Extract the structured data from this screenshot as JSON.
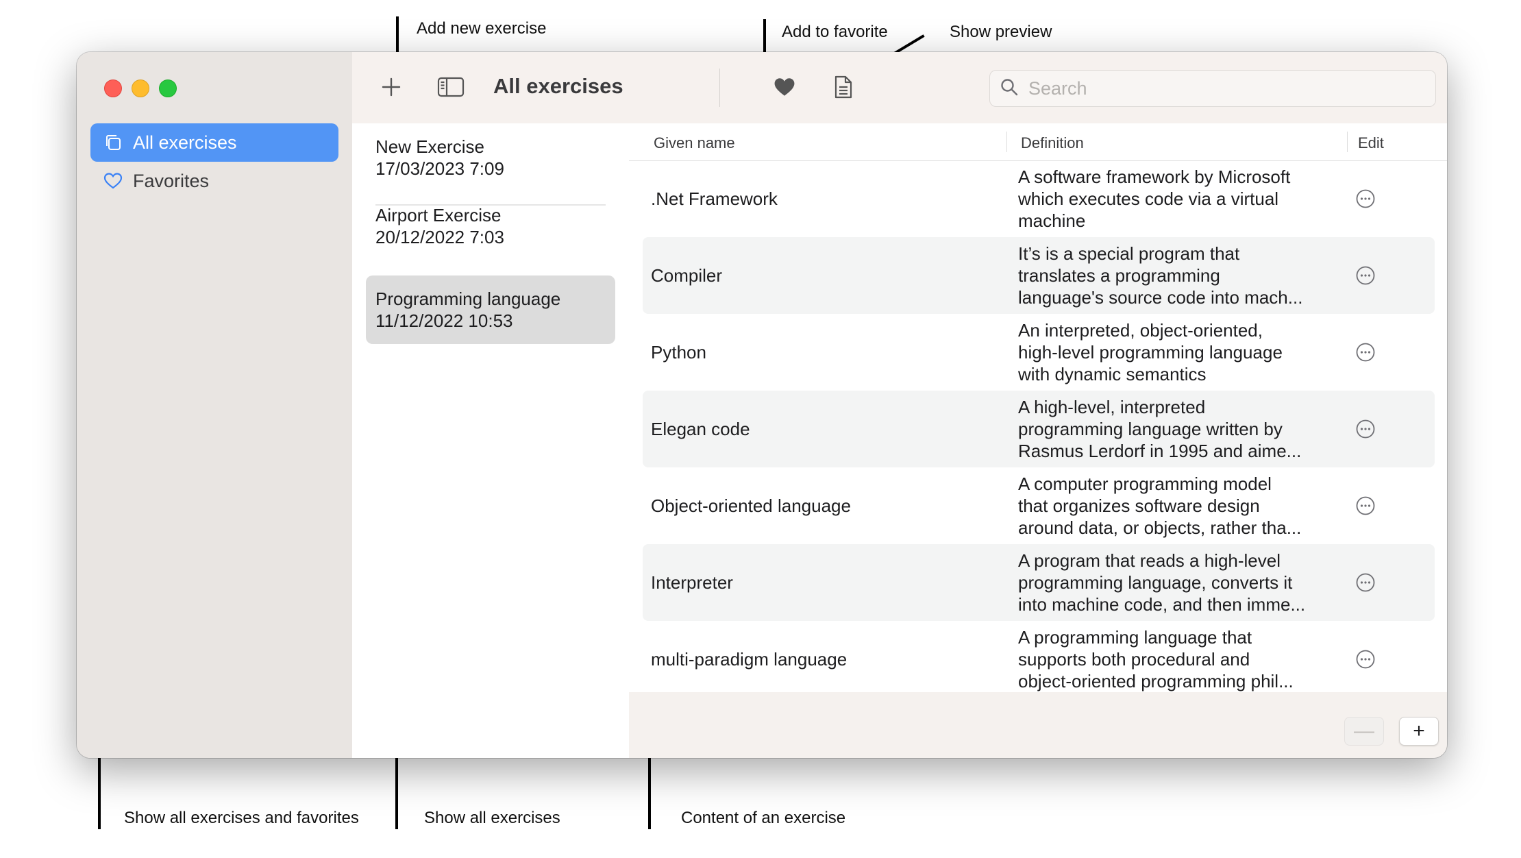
{
  "annotations": {
    "add_new_exercise": "Add new exercise",
    "add_to_favorite": "Add to favorite",
    "show_preview": "Show preview",
    "show_all_exercises_and_favorites": "Show all exercises and favorites",
    "show_all_exercises": "Show all exercises",
    "content_of_an_exercise": "Content of an exercise"
  },
  "sidebar": {
    "items": [
      {
        "label": "All exercises",
        "icon": "stacked-squares-icon",
        "active": true
      },
      {
        "label": "Favorites",
        "icon": "heart-outline-icon",
        "active": false
      }
    ]
  },
  "toolbar": {
    "title": "All exercises",
    "add_icon": "plus-icon",
    "sidebar_toggle_icon": "sidebar-icon",
    "favorite_icon": "heart-filled-icon",
    "preview_icon": "document-icon",
    "search_placeholder": "Search",
    "search_value": ""
  },
  "exercises": [
    {
      "title": "New Exercise",
      "date": "17/03/2023 7:09",
      "selected": false
    },
    {
      "title": "Airport Exercise",
      "date": "20/12/2022 7:03",
      "selected": false
    },
    {
      "title": "Programming language",
      "date": "11/12/2022 10:53",
      "selected": true
    }
  ],
  "table": {
    "columns": [
      "Given name",
      "Definition",
      "Edit"
    ],
    "rows": [
      {
        "name": ".Net Framework",
        "definition": "A software framework by Microsoft\nwhich executes code via a virtual\nmachine"
      },
      {
        "name": "Compiler",
        "definition": "It’s is a special program that\ntranslates a programming\nlanguage's source code into mach..."
      },
      {
        "name": "Python",
        "definition": "An interpreted, object-oriented,\nhigh-level programming language\nwith dynamic semantics"
      },
      {
        "name": "Elegan code",
        "definition": "A high-level, interpreted\nprogramming language written by\nRasmus Lerdorf in 1995 and aime..."
      },
      {
        "name": "Object-oriented language",
        "definition": "A computer programming model\nthat organizes software design\naround data, or objects, rather tha..."
      },
      {
        "name": "Interpreter",
        "definition": "A program that reads a high-level\nprogramming language, converts it\ninto machine code, and then imme..."
      },
      {
        "name": "multi-paradigm language",
        "definition": "A programming language that\nsupports both procedural and\nobject-oriented programming phil..."
      }
    ],
    "edit_icon": "ellipsis-circle-icon"
  },
  "bottom_bar": {
    "remove_label": "—",
    "add_label": "+"
  },
  "colors": {
    "accent": "#5295f5",
    "sidebar_bg": "#e9e5e2",
    "toolbar_bg": "#f6f1ee",
    "row_alt": "#f3f4f4",
    "selected_item": "#dcdcdc"
  }
}
